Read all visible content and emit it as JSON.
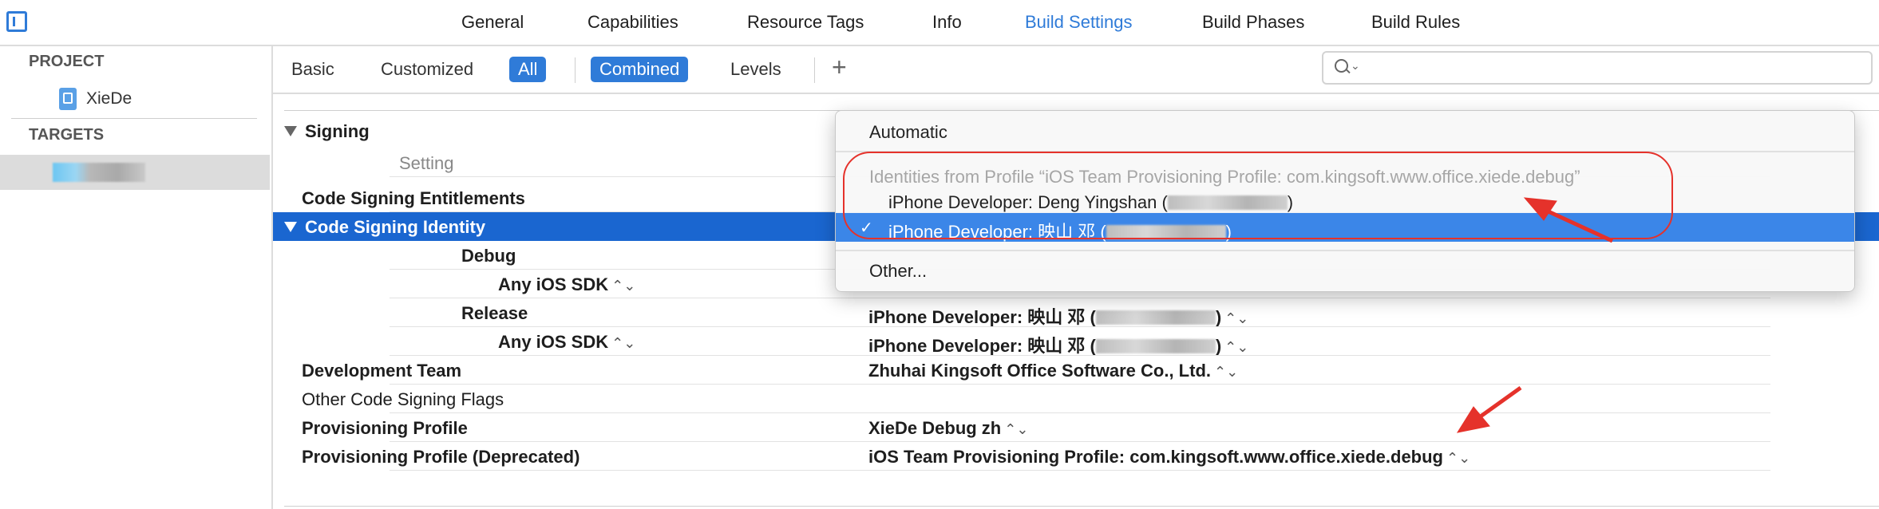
{
  "top_tabs": [
    "General",
    "Capabilities",
    "Resource Tags",
    "Info",
    "Build Settings",
    "Build Phases",
    "Build Rules"
  ],
  "active_top_tab": "Build Settings",
  "navigator": {
    "project_header": "PROJECT",
    "project_name": "XieDe",
    "targets_header": "TARGETS"
  },
  "filter_bar": {
    "basic": "Basic",
    "customized": "Customized",
    "all": "All",
    "combined": "Combined",
    "levels": "Levels",
    "add": "+",
    "search_placeholder": ""
  },
  "section": {
    "title": "Signing",
    "column_header": "Setting"
  },
  "rows": {
    "entitlements": "Code Signing Entitlements",
    "identity": "Code Signing Identity",
    "debug": "Debug",
    "debug_sdk": "Any iOS SDK",
    "release": "Release",
    "release_value": "iPhone Developer: 映山 邓 (",
    "release_sdk": "Any iOS SDK",
    "release_sdk_value": "iPhone Developer: 映山 邓 (",
    "dev_team": "Development Team",
    "dev_team_value": "Zhuhai Kingsoft Office Software Co., Ltd.",
    "other_flags": "Other Code Signing Flags",
    "prov_profile": "Provisioning Profile",
    "prov_profile_value": "XieDe Debug zh",
    "prov_profile_dep": "Provisioning Profile (Deprecated)",
    "prov_profile_dep_value": "iOS Team Provisioning Profile: com.kingsoft.www.office.xiede.debug",
    "close_paren": ")",
    "stepper_glyph": "⌃⌄"
  },
  "popup_menu": {
    "automatic": "Automatic",
    "identities_header": "Identities from Profile “iOS Team Provisioning Profile: com.kingsoft.www.office.xiede.debug”",
    "identity_1": "iPhone Developer: Deng Yingshan (",
    "identity_2": "iPhone Developer: 映山 邓 (",
    "close_paren": ")",
    "check": "✓",
    "other": "Other..."
  },
  "colors": {
    "accent": "#2f7bd8",
    "selection": "#1a66d0",
    "annotation": "#e5322b"
  }
}
